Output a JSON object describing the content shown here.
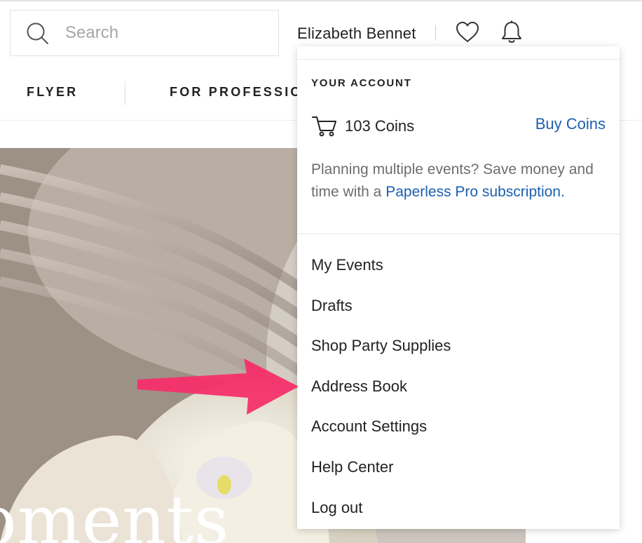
{
  "header": {
    "search": {
      "placeholder": "Search",
      "value": ""
    },
    "user_name": "Elizabeth Bennet",
    "icons": [
      "search-icon",
      "heart-icon",
      "bell-icon"
    ]
  },
  "nav": {
    "items": [
      {
        "label": "FLYER"
      },
      {
        "label": "FOR PROFESSIONALS"
      }
    ]
  },
  "hero": {
    "text": "oments"
  },
  "account_menu": {
    "heading": "YOUR ACCOUNT",
    "coins_text": "103 Coins",
    "buy_coins_label": "Buy Coins",
    "promo_prefix": "Planning multiple events? Save money and time with a ",
    "promo_link": "Paperless Pro subscription.",
    "items": [
      {
        "label": "My Events"
      },
      {
        "label": "Drafts"
      },
      {
        "label": "Shop Party Supplies"
      },
      {
        "label": "Address Book"
      },
      {
        "label": "Account Settings"
      },
      {
        "label": "Help Center"
      },
      {
        "label": "Log out"
      }
    ]
  },
  "colors": {
    "link": "#1d5fb0",
    "arrow": "#f5306a",
    "text": "#222222",
    "muted": "#6d6d6d"
  }
}
